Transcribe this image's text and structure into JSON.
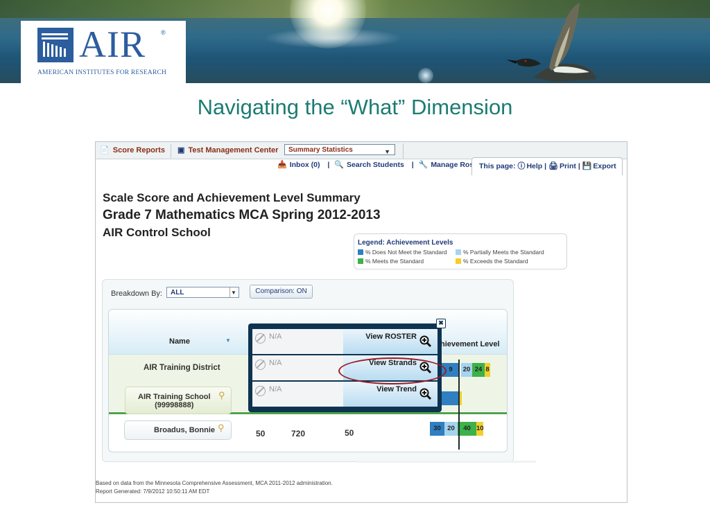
{
  "banner": {
    "logo": {
      "name": "AIR",
      "subtitle": "AMERICAN INSTITUTES FOR RESEARCH",
      "registered": "®"
    }
  },
  "slide": {
    "title": "Navigating the “What” Dimension"
  },
  "app": {
    "tabs": [
      {
        "label": "Score Reports",
        "icon": "report-icon"
      },
      {
        "label": "Test Management Center",
        "icon": "briefcase-icon"
      }
    ],
    "summary_select": {
      "value": "Summary Statistics"
    },
    "links": [
      {
        "label": "Inbox (0)",
        "icon": "inbox-icon"
      },
      {
        "label": "Search Students",
        "icon": "search-icon"
      },
      {
        "label": "Manage Roster",
        "icon": "wrench-icon"
      }
    ],
    "this_page": {
      "label": "This page:",
      "actions": [
        {
          "label": "Help",
          "icon": "help-icon"
        },
        {
          "label": "Print",
          "icon": "print-icon"
        },
        {
          "label": "Export",
          "icon": "export-icon"
        }
      ]
    }
  },
  "report": {
    "title": "Scale Score and Achievement Level Summary",
    "subtitle": "Grade 7 Mathematics MCA Spring 2012-2013",
    "school": "AIR Control School",
    "legend": {
      "title": "Legend: Achievement Levels",
      "items": [
        {
          "label": "% Does Not Meet the Standard",
          "color": "#2f7fc1"
        },
        {
          "label": "% Partially Meets the Standard",
          "color": "#a6d3ee"
        },
        {
          "label": "% Meets the Standard",
          "color": "#3db14a"
        },
        {
          "label": "% Exceeds the Standard",
          "color": "#f2cf2e"
        }
      ]
    },
    "breakdown": {
      "label": "Breakdown By:",
      "value": "ALL"
    },
    "comparison": {
      "label": "Comparison: ON"
    },
    "table": {
      "name_header": "Name",
      "achievement_header": "hievement Level",
      "rows": [
        {
          "name": "AIR Training District",
          "bars": [
            {
              "label": "9",
              "color": "#2f7fc1"
            },
            {
              "label": "20",
              "color": "#a6d3ee"
            },
            {
              "label": "24",
              "color": "#3db14a"
            },
            {
              "label": "8",
              "color": "#f2cf2e"
            }
          ]
        },
        {
          "name": "AIR Training School",
          "id": "(99998888)",
          "bars": [
            {
              "label": "",
              "color": "#2f7fc1"
            },
            {
              "label": "",
              "color": "#f2cf2e"
            }
          ]
        },
        {
          "name": "Broadus, Bonnie",
          "count": "50",
          "scale_score": "720",
          "col3": "50",
          "bars": [
            {
              "label": "30",
              "color": "#2f7fc1"
            },
            {
              "label": "20",
              "color": "#a6d3ee"
            },
            {
              "label": "40",
              "color": "#3db14a"
            },
            {
              "label": "10",
              "color": "#f2cf2e"
            }
          ]
        }
      ]
    },
    "popup": {
      "rows": [
        {
          "na": "N/A",
          "action": "View ROSTER"
        },
        {
          "na": "N/A",
          "action": "View Strands"
        },
        {
          "na": "N/A",
          "action": "View Trend"
        }
      ]
    },
    "footer": {
      "line1": "Based on data from the Minnesota Comprehensive Assessment, MCA 2011-2012 administration.",
      "line2": "Report Generated: 7/9/2012 10:50:11 AM EDT"
    }
  }
}
